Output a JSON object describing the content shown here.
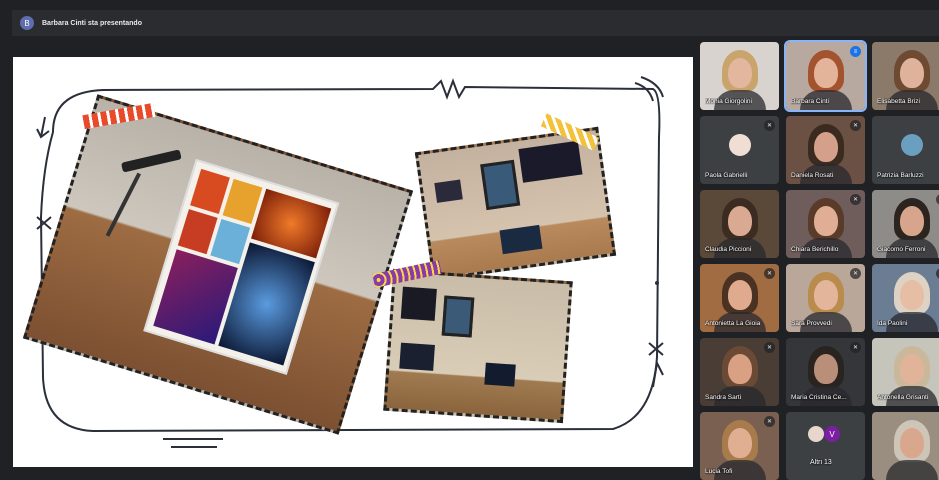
{
  "topbar": {
    "avatar_letter": "B",
    "presenting_text": "Barbara Cinti sta presentando"
  },
  "slide": {
    "name": "presentation-slide"
  },
  "participants": [
    {
      "name": "Monia Giorgolini",
      "muted": false,
      "speaking": false,
      "bg": "#d8d3cf",
      "skin": "#e2b79e",
      "hair": "#c9a56d"
    },
    {
      "name": "Barbara Cinti",
      "muted": false,
      "speaking": true,
      "bg": "#b8a9a0",
      "skin": "#e4b49a",
      "hair": "#a4532f"
    },
    {
      "name": "Elisabetta Brizi",
      "muted": false,
      "speaking": false,
      "bg": "#8b7a6a",
      "skin": "#dfb29b",
      "hair": "#6e4a32"
    },
    {
      "name": "Paola Gabrielli",
      "muted": true,
      "speaking": false,
      "bg": "#3c4043",
      "avatar": true,
      "avatar_color": "#f0ded4"
    },
    {
      "name": "Daniela Rosati",
      "muted": true,
      "speaking": false,
      "bg": "#6b5143",
      "skin": "#d4a08a",
      "hair": "#3a2a20"
    },
    {
      "name": "Patrizia Barluzzi",
      "muted": false,
      "speaking": false,
      "bg": "#3c4043",
      "avatar": true,
      "avatar_color": "#6a9fc0"
    },
    {
      "name": "Claudia Piccioni",
      "muted": false,
      "speaking": false,
      "bg": "#5a4838",
      "skin": "#d9a991",
      "hair": "#3b2b20"
    },
    {
      "name": "Chiara Berichillo",
      "muted": true,
      "speaking": false,
      "bg": "#6f5d5c",
      "skin": "#e0ae95",
      "hair": "#5a3a28"
    },
    {
      "name": "Giacomo Ferroni",
      "muted": true,
      "speaking": false,
      "bg": "#8d8c88",
      "skin": "#d6a58b",
      "hair": "#2b241f"
    },
    {
      "name": "Antonietta La Gioia",
      "muted": true,
      "speaking": false,
      "bg": "#a26c43",
      "skin": "#dfaa8e",
      "hair": "#4a3222"
    },
    {
      "name": "Sara Provvedi",
      "muted": true,
      "speaking": false,
      "bg": "#b9a79a",
      "skin": "#e3b59b",
      "hair": "#b98b4c"
    },
    {
      "name": "Ida Paolini",
      "muted": true,
      "speaking": false,
      "bg": "#6a7d93",
      "skin": "#e6bda5",
      "hair": "#ddd2c4"
    },
    {
      "name": "Sandra Sarti",
      "muted": true,
      "speaking": false,
      "bg": "#4a3d36",
      "skin": "#d9a084",
      "hair": "#6b4a35"
    },
    {
      "name": "Maria Cristina Ce...",
      "muted": true,
      "speaking": false,
      "bg": "#35363a",
      "skin": "#b98f7a",
      "hair": "#2a2420"
    },
    {
      "name": "Antonella Grisanti",
      "muted": false,
      "speaking": false,
      "bg": "#c5c5bc",
      "skin": "#e1b49a",
      "hair": "#c9b89a"
    },
    {
      "name": "Lucia Tofi",
      "muted": true,
      "speaking": false,
      "bg": "#7a6050",
      "skin": "#e0ae90",
      "hair": "#a87b4d"
    },
    {
      "name": "Altri 13",
      "muted": false,
      "speaking": false,
      "bg": "#3c4043",
      "others": true,
      "others_letter": "V"
    },
    {
      "name": "",
      "muted": false,
      "speaking": false,
      "bg": "#9a8e80",
      "skin": "#d8a78e",
      "hair": "#cfc4b8"
    }
  ]
}
